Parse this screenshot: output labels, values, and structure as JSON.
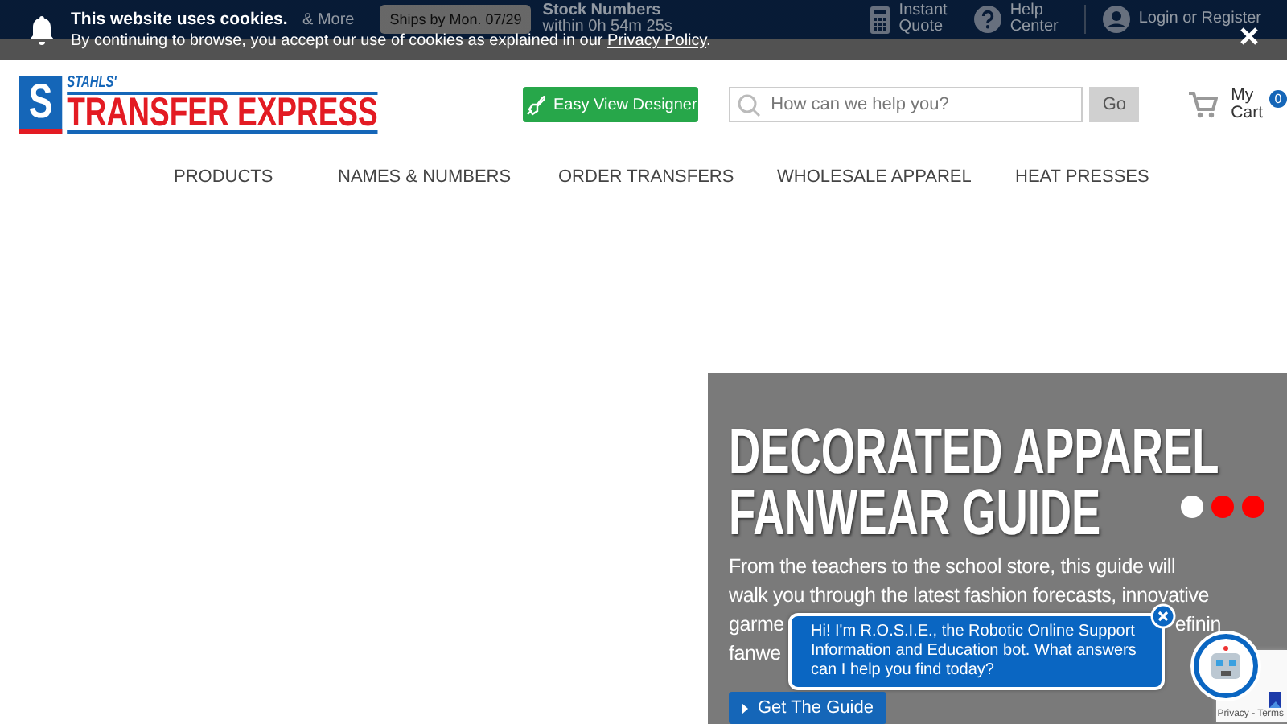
{
  "top_bar": {
    "tagline_fragment": "& More",
    "ship_badge": "Ships by Mon. 07/29",
    "stock": {
      "title": "Stock Numbers",
      "countdown": "within 0h 54m 25s"
    },
    "links": [
      {
        "kind": "quote",
        "label_lines": [
          "Instant",
          "Quote"
        ]
      },
      {
        "kind": "help",
        "label_lines": [
          "Help",
          "Center"
        ]
      },
      {
        "kind": "account",
        "label_lines": [
          "Login or Register"
        ]
      }
    ]
  },
  "cookie_banner": {
    "title": "This website uses cookies.",
    "message": "By continuing to browse, you accept our use of cookies as explained in our ",
    "link": "Privacy Policy",
    "end": "."
  },
  "header": {
    "logo": {
      "brand": "STAHLS'",
      "name": "TRANSFER EXPRESS",
      "mark": "S"
    },
    "designer_button": "Easy View Designer",
    "search": {
      "placeholder": "How can we help you?",
      "button": "Go"
    },
    "cart": {
      "label_lines": [
        "My",
        "Cart"
      ],
      "count": "0"
    }
  },
  "nav": [
    "PRODUCTS",
    "NAMES & NUMBERS",
    "ORDER TRANSFERS",
    "WHOLESALE APPAREL",
    "HEAT PRESSES"
  ],
  "hero": {
    "title_lines": [
      "DECORATED APPAREL",
      "FANWEAR GUIDE"
    ],
    "text_lines": [
      "From the teachers to the school store, this guide will",
      "walk you through the latest fashion forecasts, innovative"
    ],
    "covered_fragments": [
      {
        "left": "garme",
        "right": "efinin"
      },
      {
        "left": "fanwe"
      }
    ],
    "button": "Get The Guide",
    "dots": [
      {
        "selected": true
      },
      {
        "selected": false
      },
      {
        "selected": false
      }
    ]
  },
  "chat": {
    "message": "Hi! I'm R.O.S.I.E., the Robotic Online Support Information and Education bot. What answers can I help you find today?"
  },
  "recaptcha": {
    "links": "Privacy - Terms"
  }
}
